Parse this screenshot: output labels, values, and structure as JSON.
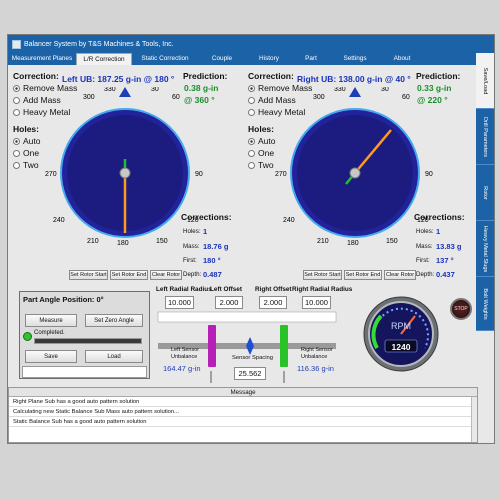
{
  "window": {
    "title": "Balancer System by T&S Machines & Tools, Inc."
  },
  "tabs": [
    "Measurement Planes",
    "L/R Correction",
    "Static Correction",
    "Couple",
    "History",
    "Part",
    "Settings",
    "About"
  ],
  "side_tabs": [
    "Save/Load",
    "Drill Parameters",
    "Rotor",
    "Heavy Metal Slugs",
    "Bolt Weights"
  ],
  "left": {
    "correction_label": "Correction:",
    "ub": "Left UB: 187.25 g-in @ 180 °",
    "prediction_label": "Prediction:",
    "pred_value": "0.38 g-in",
    "pred_angle": "@ 360 °",
    "modes": [
      "Remove Mass",
      "Add Mass",
      "Heavy Metal"
    ],
    "holes_label": "Holes:",
    "holes": [
      "Auto",
      "One",
      "Two"
    ],
    "dial": [
      "300",
      "330",
      "0",
      "30",
      "60",
      "270",
      "240",
      "210",
      "180",
      "150",
      "120",
      "90"
    ],
    "corr_title": "Corrections:",
    "corr": [
      [
        "Holes:",
        "1"
      ],
      [
        "Mass:",
        "18.76 g"
      ],
      [
        "First:",
        "180 °"
      ],
      [
        "Depth:",
        "0.487"
      ]
    ],
    "buttons": [
      "Set Rotor Start",
      "Set Rotor End",
      "Clear Rotor"
    ]
  },
  "right": {
    "correction_label": "Correction:",
    "ub": "Right UB: 138.00 g-in @ 40 °",
    "prediction_label": "Prediction:",
    "pred_value": "0.33 g-in",
    "pred_angle": "@ 220 °",
    "modes": [
      "Remove Mass",
      "Add Mass",
      "Heavy Metal"
    ],
    "holes_label": "Holes:",
    "holes": [
      "Auto",
      "One",
      "Two"
    ],
    "dial": [
      "300",
      "330",
      "0",
      "30",
      "60",
      "270",
      "240",
      "210",
      "180",
      "150",
      "120",
      "90"
    ],
    "corr_title": "Corrections:",
    "corr": [
      [
        "Holes:",
        "1"
      ],
      [
        "Mass:",
        "13.83 g"
      ],
      [
        "First:",
        "137 °"
      ],
      [
        "Depth:",
        "0.437"
      ]
    ],
    "buttons": [
      "Set Rotor Start",
      "Set Rotor End",
      "Clear Rotor"
    ]
  },
  "part_angle": {
    "title": "Part Angle Position: 0°",
    "measure": "Measure",
    "set_zero": "Set Zero Angle",
    "status": "Completed.",
    "save": "Save",
    "load": "Load"
  },
  "rotor_params": {
    "left_radius_label": "Left Radial Radius",
    "left_radius": "10.000",
    "left_offset_label": "Left Offset",
    "left_offset": "2.000",
    "right_offset_label": "Right Offset",
    "right_offset": "2.000",
    "right_radius_label": "Right Radial Radius",
    "right_radius": "10.000",
    "left_sensor_label": "Left Sensor Unbalance",
    "left_sensor": "164.47 g-in",
    "spacing_label": "Sensor Spacing",
    "spacing": "25.562",
    "right_sensor_label": "Right Sensor Unbalance",
    "right_sensor": "116.36 g-in"
  },
  "gauge": {
    "label": "RPM",
    "value": "1240",
    "stop": "STOP"
  },
  "messages": {
    "header": "Message",
    "rows": [
      "Right Plane Sub has a good auto pattern solution",
      "Calculating new Static Balance Sub Mass auto pattern solution...",
      "Static Balance Sub has a good auto pattern solution"
    ]
  }
}
